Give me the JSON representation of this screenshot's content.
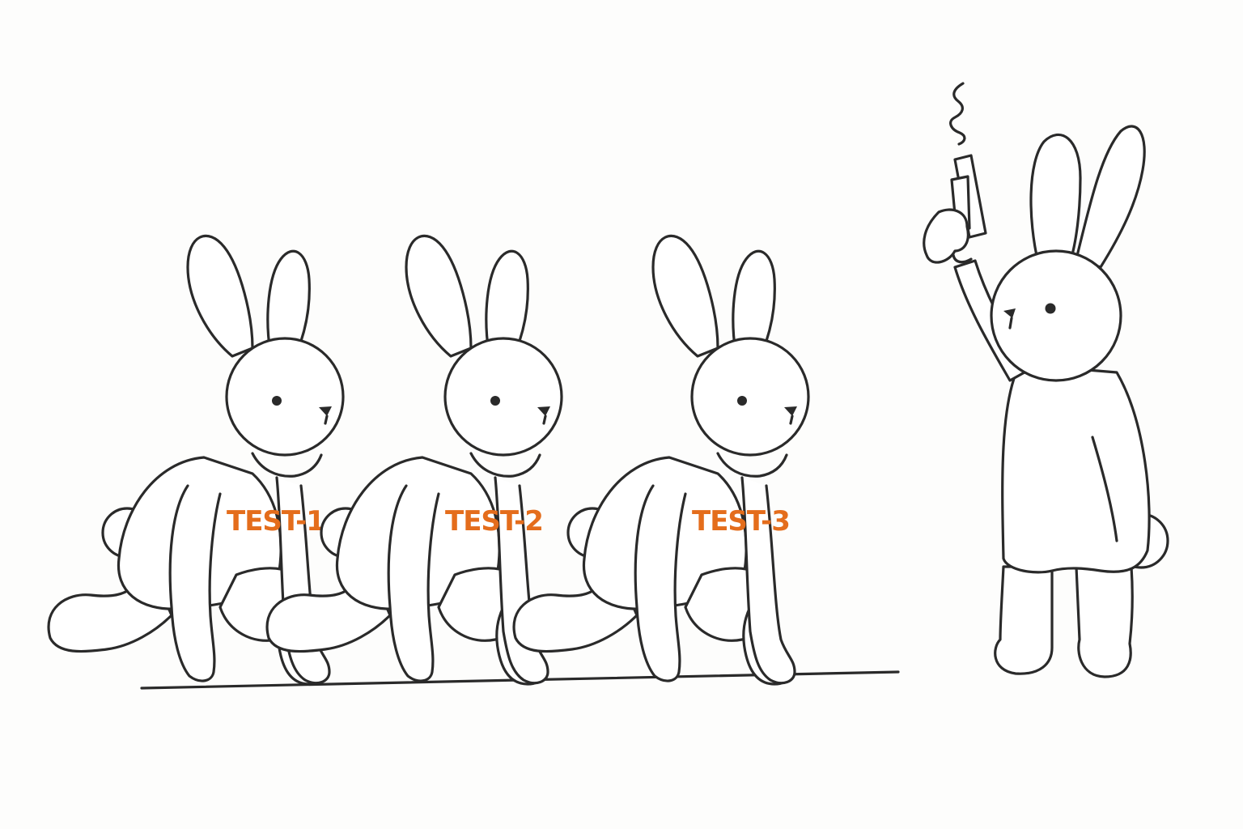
{
  "runners": [
    {
      "bib": "TEST-1"
    },
    {
      "bib": "TEST-2"
    },
    {
      "bib": "TEST-3"
    }
  ],
  "colors": {
    "bib_text": "#e46d1c",
    "ink": "#2a2a2a",
    "background": "#fdfdfc"
  },
  "icons": {
    "starter_prop": "starting-pistol-icon",
    "smoke": "smoke-squiggle-icon"
  }
}
